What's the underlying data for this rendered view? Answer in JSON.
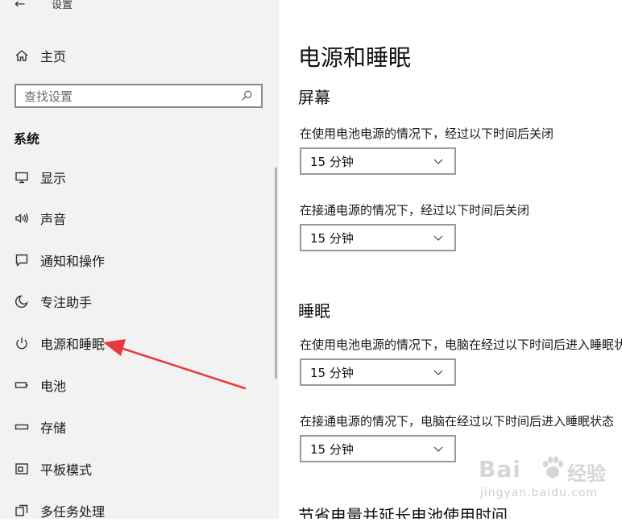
{
  "header": {
    "back_icon": "back-arrow-icon",
    "title": "设置"
  },
  "sidebar": {
    "home": {
      "label": "主页",
      "icon": "home-icon"
    },
    "search": {
      "placeholder": "查找设置",
      "icon": "search-icon"
    },
    "section_label": "系统",
    "items": [
      {
        "label": "显示",
        "icon": "monitor-icon"
      },
      {
        "label": "声音",
        "icon": "speaker-icon"
      },
      {
        "label": "通知和操作",
        "icon": "notification-icon"
      },
      {
        "label": "专注助手",
        "icon": "moon-icon"
      },
      {
        "label": "电源和睡眠",
        "icon": "power-icon"
      },
      {
        "label": "电池",
        "icon": "battery-icon"
      },
      {
        "label": "存储",
        "icon": "storage-icon"
      },
      {
        "label": "平板模式",
        "icon": "tablet-mode-icon"
      },
      {
        "label": "多任务处理",
        "icon": "multitasking-icon"
      }
    ]
  },
  "main": {
    "title": "电源和睡眠",
    "screen": {
      "heading": "屏幕",
      "battery_label": "在使用电池电源的情况下，经过以下时间后关闭",
      "battery_value": "15 分钟",
      "plugged_label": "在接通电源的情况下，经过以下时间后关闭",
      "plugged_value": "15 分钟"
    },
    "sleep": {
      "heading": "睡眠",
      "battery_label": "在使用电池电源的情况下，电脑在经过以下时间后进入睡眠状态",
      "battery_value": "15 分钟",
      "plugged_label": "在接通电源的情况下，电脑在经过以下时间后进入睡眠状态",
      "plugged_value": "15 分钟"
    },
    "next_heading": "节省电量并延长电池使用时间"
  },
  "annotation": {
    "arrow_color": "#e8393c"
  },
  "watermark": {
    "brand": "Bai",
    "suffix": "经验",
    "url": "jingyan.baidu.com"
  },
  "colors": {
    "sidebar_bg": "#f2f2f2",
    "main_bg": "#ffffff",
    "text": "#1a1a1a"
  }
}
